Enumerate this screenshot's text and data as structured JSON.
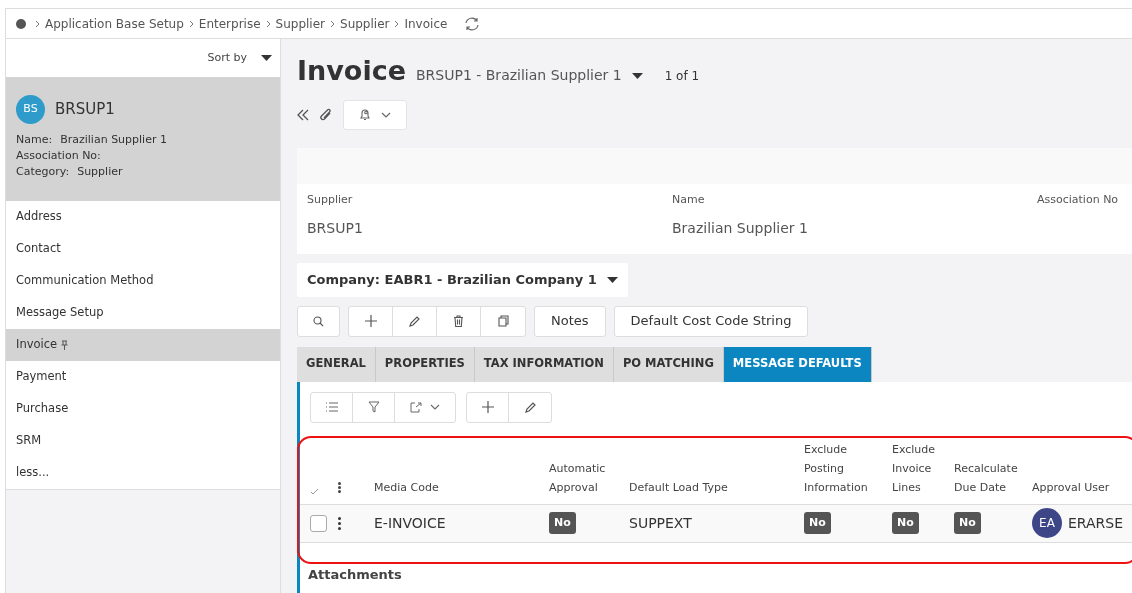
{
  "breadcrumb": [
    "Application Base Setup",
    "Enterprise",
    "Supplier",
    "Supplier",
    "Invoice"
  ],
  "sidebar": {
    "sort_label": "Sort by",
    "record": {
      "initials": "BS",
      "id": "BRSUP1",
      "fields": [
        {
          "label": "Name:",
          "value": "Brazilian Supplier 1"
        },
        {
          "label": "Association No:"
        },
        {
          "label": "Category:",
          "value": "Supplier"
        }
      ]
    },
    "items": [
      {
        "label": "Address",
        "selected": false,
        "pinned": false
      },
      {
        "label": "Contact",
        "selected": false,
        "pinned": false
      },
      {
        "label": "Communication Method",
        "selected": false,
        "pinned": false
      },
      {
        "label": "Message Setup",
        "selected": false,
        "pinned": false
      },
      {
        "label": "Invoice",
        "selected": true,
        "pinned": true
      },
      {
        "label": "Payment",
        "selected": false,
        "pinned": false
      },
      {
        "label": "Purchase",
        "selected": false,
        "pinned": false
      },
      {
        "label": "SRM",
        "selected": false,
        "pinned": false
      },
      {
        "label": "less...",
        "selected": false,
        "pinned": false
      }
    ]
  },
  "page": {
    "title": "Invoice",
    "record": "BRSUP1 - Brazilian Supplier 1",
    "counter": "1 of 1"
  },
  "header_fields": [
    {
      "label": "Supplier",
      "value": "BRSUP1"
    },
    {
      "label": "Name",
      "value": "Brazilian Supplier 1"
    },
    {
      "label": "Association No"
    }
  ],
  "company": "Company: EABR1 - Brazilian Company 1",
  "buttons": [
    "Notes",
    "Default Cost Code String"
  ],
  "tabs": [
    {
      "label": "GENERAL",
      "selected": false
    },
    {
      "label": "PROPERTIES",
      "selected": false
    },
    {
      "label": "TAX INFORMATION",
      "selected": false
    },
    {
      "label": "PO MATCHING",
      "selected": false
    },
    {
      "label": "MESSAGE DEFAULTS",
      "selected": true
    }
  ],
  "table": {
    "columns": [
      "Media Code",
      "Automatic Approval",
      "Default Load Type",
      "Exclude Posting Information",
      "Exclude Invoice Lines",
      "Recalculate Due Date",
      "Approval User"
    ],
    "rows": [
      {
        "selected": false,
        "cells": [
          {
            "kind": "text",
            "text": "E-INVOICE"
          },
          {
            "kind": "badge",
            "text": "No"
          },
          {
            "kind": "text",
            "text": "SUPPEXT"
          },
          {
            "kind": "badge",
            "text": "No"
          },
          {
            "kind": "badge",
            "text": "No"
          },
          {
            "kind": "badge",
            "text": "No"
          },
          {
            "kind": "user",
            "initials": "EA",
            "text": "ERARSE"
          }
        ]
      }
    ]
  },
  "attachments_title": "Attachments"
}
